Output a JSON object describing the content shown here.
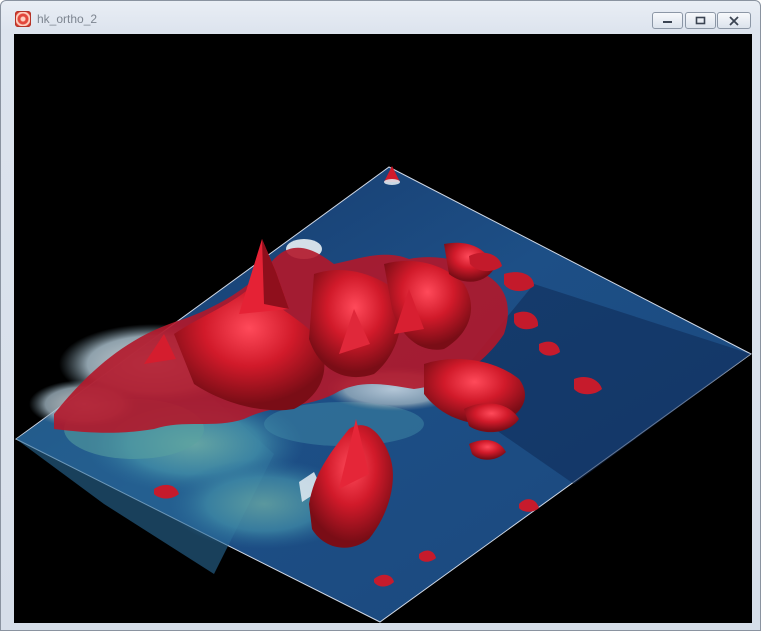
{
  "window": {
    "title": "hk_ortho_2",
    "controls": {
      "minimize": "minimize",
      "maximize": "maximize",
      "close": "close"
    }
  },
  "viewport": {
    "content": "3D terrain view",
    "background": "#000000",
    "colors": {
      "water": "#1d4f86",
      "water_deep": "#12264c",
      "shallow": "#3f8aa6",
      "terrain": "#d11a2a",
      "terrain_dark": "#7a0d16",
      "urban": "#cfd7dc"
    }
  }
}
